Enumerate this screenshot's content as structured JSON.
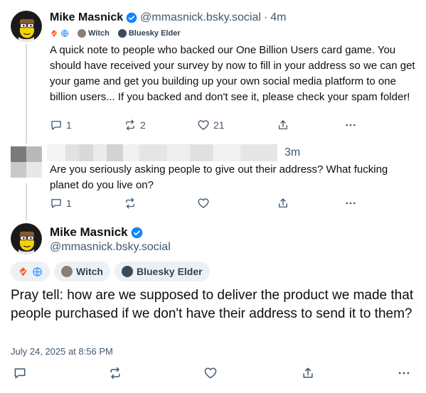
{
  "post1": {
    "name": "Mike Masnick",
    "handle": "@mmasnick.bsky.social",
    "sep": "·",
    "time": "4m",
    "badges": [
      "Witch",
      "Bluesky Elder"
    ],
    "text": "A quick note to people who backed our One Billion Users card game. You should have received your survey by now to fill in your address so we can get your game and get you building up your own social media platform to one billion users... If you backed and don't see it, please check your spam folder!",
    "replies": "1",
    "reposts": "2",
    "likes": "21"
  },
  "post2": {
    "time": "3m",
    "text": "Are you seriously asking people to give out their address? What fucking planet do you live on?",
    "replies": "1"
  },
  "post3": {
    "name": "Mike Masnick",
    "handle": "@mmasnick.bsky.social",
    "badges": [
      "Witch",
      "Bluesky Elder"
    ],
    "text": "Pray tell: how are we supposed to deliver the product we made that people purchased if we don't have their address to send it to them?",
    "date": "July 24, 2025 at 8:56 PM"
  },
  "icons": {
    "verified": "verified-check-icon",
    "reply": "reply-icon",
    "repost": "repost-icon",
    "like": "heart-icon",
    "share": "share-icon",
    "more": "more-icon"
  },
  "colors": {
    "verified": "#1185fe",
    "badge_orange": "#ff5a1f",
    "muted": "#42576c",
    "thread_line": "#d4dbe2"
  }
}
